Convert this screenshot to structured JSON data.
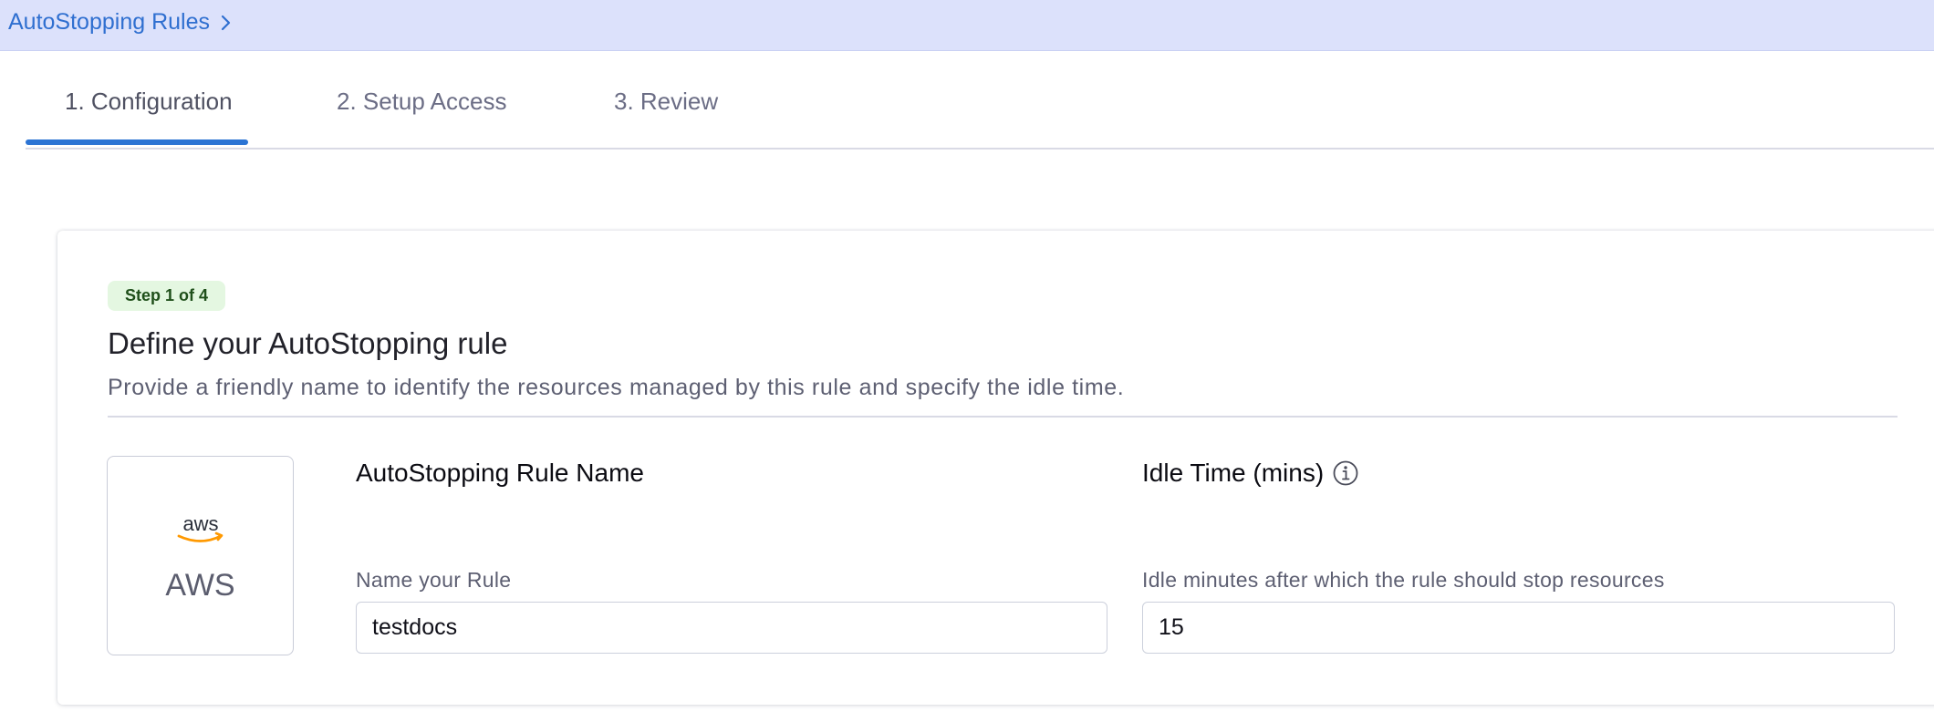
{
  "breadcrumb": {
    "label": "AutoStopping Rules"
  },
  "tabs": [
    {
      "label": "1. Configuration",
      "active": true
    },
    {
      "label": "2. Setup Access",
      "active": false
    },
    {
      "label": "3. Review",
      "active": false
    }
  ],
  "colors": {
    "accent": "#2b74d4",
    "breadcrumb_bg": "#dce1fb",
    "badge_bg": "#e4f7e1",
    "badge_text": "#1f4f1a",
    "aws_orange": "#ff9900"
  },
  "card": {
    "step_badge": "Step 1 of 4",
    "title": "Define your AutoStopping rule",
    "description": "Provide a friendly name to identify the resources managed by this rule and specify the idle time."
  },
  "provider": {
    "logo_text": "aws",
    "label": "AWS",
    "icon": "aws-logo-icon"
  },
  "rule_name": {
    "heading": "AutoStopping Rule Name",
    "field_label": "Name your Rule",
    "value": "testdocs"
  },
  "idle_time": {
    "heading": "Idle Time (mins)",
    "info_icon": "info-icon",
    "field_label": "Idle minutes after which the rule should stop resources",
    "value": "15"
  }
}
